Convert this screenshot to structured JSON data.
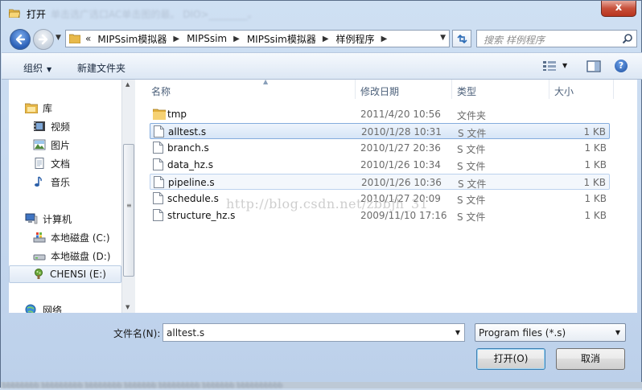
{
  "window": {
    "title": "打开",
    "title_blurred_suffix": "单击选广选口AC单击图的最。 DIO>________。",
    "close_label": "x"
  },
  "address": {
    "overflow": "«",
    "crumbs": [
      "MIPSsim模拟器",
      "MIPSsim",
      "MIPSsim模拟器",
      "样例程序"
    ],
    "search_placeholder": "搜索 样例程序"
  },
  "toolbar": {
    "organize_label": "组织",
    "new_folder_label": "新建文件夹"
  },
  "nav": {
    "items": [
      {
        "label": "库",
        "icon": "library-icon"
      },
      {
        "label": "视频",
        "icon": "video-icon"
      },
      {
        "label": "图片",
        "icon": "pictures-icon"
      },
      {
        "label": "文档",
        "icon": "documents-icon"
      },
      {
        "label": "音乐",
        "icon": "music-icon"
      },
      {
        "label": "计算机",
        "icon": "computer-icon"
      },
      {
        "label": "本地磁盘 (C:)",
        "icon": "drive-c-icon"
      },
      {
        "label": "本地磁盘 (D:)",
        "icon": "drive-d-icon"
      },
      {
        "label": "CHENSI (E:)",
        "icon": "usb-drive-icon"
      },
      {
        "label": "网络",
        "icon": "network-icon"
      }
    ]
  },
  "filelist": {
    "columns": {
      "name": "名称",
      "date": "修改日期",
      "type": "类型",
      "size": "大小"
    },
    "rows": [
      {
        "name": "tmp",
        "date": "2011/4/20 10:56",
        "type": "文件夹",
        "size": "",
        "kind": "folder"
      },
      {
        "name": "alltest.s",
        "date": "2010/1/28 10:31",
        "type": "S 文件",
        "size": "1 KB",
        "kind": "file",
        "state": "selected"
      },
      {
        "name": "branch.s",
        "date": "2010/1/27 20:36",
        "type": "S 文件",
        "size": "1 KB",
        "kind": "file"
      },
      {
        "name": "data_hz.s",
        "date": "2010/1/26 10:34",
        "type": "S 文件",
        "size": "1 KB",
        "kind": "file"
      },
      {
        "name": "pipeline.s",
        "date": "2010/1/26 10:36",
        "type": "S 文件",
        "size": "1 KB",
        "kind": "file",
        "state": "hover"
      },
      {
        "name": "schedule.s",
        "date": "2010/1/27 20:09",
        "type": "S 文件",
        "size": "1 KB",
        "kind": "file"
      },
      {
        "name": "structure_hz.s",
        "date": "2009/11/10 17:16",
        "type": "S 文件",
        "size": "1 KB",
        "kind": "file"
      }
    ],
    "watermark": "http://blog.csdn.net/zbbjh_31"
  },
  "footer": {
    "filename_label": "文件名(N):",
    "filename_value": "alltest.s",
    "filetype_value": "Program files (*.s)",
    "open_label": "打开(O)",
    "cancel_label": "取消",
    "blurred_strip": "bbbbbbbb  bbbbbbbbb  bbbbbbbb  bbbbbbb  bbbbbbbbb  bbbbbbb  bbbbbbbbbb"
  }
}
